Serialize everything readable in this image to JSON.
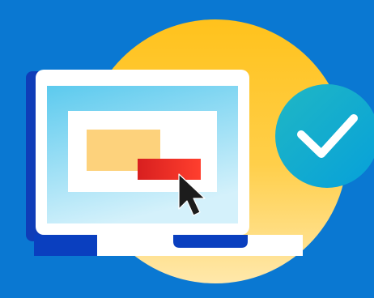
{
  "illustration": {
    "icons": [
      "laptop-icon",
      "cursor-arrow-icon",
      "checkmark-icon"
    ],
    "colors": {
      "background": "#0a78d2",
      "sun_top": "#ffc21c",
      "sun_bottom": "#ffe7a6",
      "laptop_frame": "#ffffff",
      "laptop_shadow": "#0f3db8",
      "screen_top": "#62cdee",
      "screen_bottom": "#cfeffa",
      "window": "#ffffff",
      "yellow_block": "#fdd27c",
      "red_button_start": "#d91f1f",
      "red_button_end": "#ff3b2e",
      "cursor": "#1c1c1c",
      "check_badge_start": "#1fb6c8",
      "check_badge_end": "#0aa2d6",
      "check_mark": "#ffffff",
      "base_left": "#0a3fbf",
      "base_notch": "#0a3fbf"
    }
  }
}
